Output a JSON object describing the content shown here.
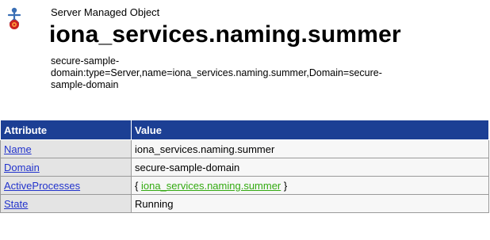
{
  "header": {
    "icon": "server-person-icon",
    "type_label": "Server Managed Object",
    "title": "iona_services.naming.summer",
    "object_name_lines": [
      "secure-sample-",
      "domain:type=Server,name=iona_services.naming.summer,Domain=secure-",
      "sample-domain"
    ]
  },
  "table": {
    "headers": {
      "attribute": "Attribute",
      "value": "Value"
    },
    "rows": [
      {
        "attribute": "Name",
        "value": "iona_services.naming.summer"
      },
      {
        "attribute": "Domain",
        "value": "secure-sample-domain"
      },
      {
        "attribute": "ActiveProcesses",
        "value_prefix": "{ ",
        "value_link": "iona_services.naming.summer",
        "value_suffix": " }"
      },
      {
        "attribute": "State",
        "value": "Running"
      }
    ]
  },
  "colors": {
    "header_bg": "#1c3f94",
    "link": "#2233cc",
    "green_link": "#33aa11",
    "row_bg": "#e4e4e4"
  }
}
